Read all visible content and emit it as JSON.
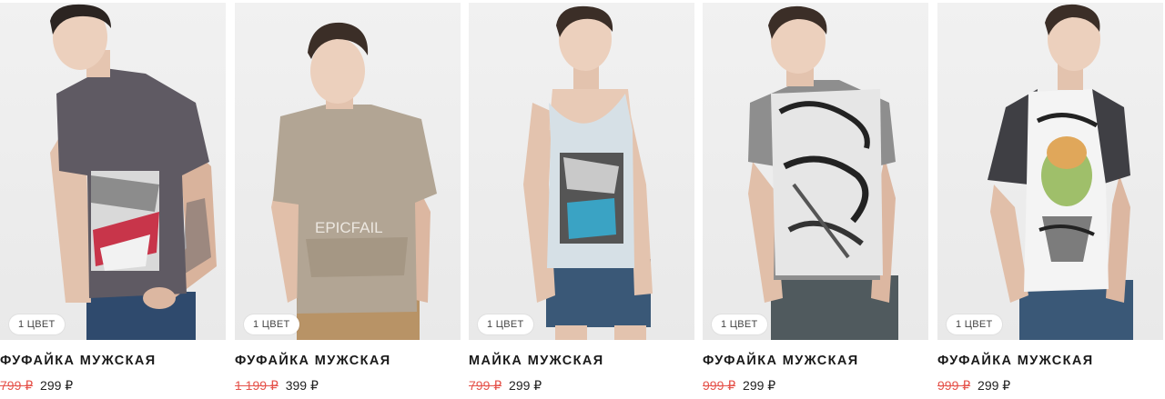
{
  "products": [
    {
      "title": "ФУФАЙКА МУЖСКАЯ",
      "colors_badge": "1 ЦВЕТ",
      "old_price": "799 ₽",
      "new_price": "299 ₽",
      "shirt_color": "#5f5a63",
      "print_text": ""
    },
    {
      "title": "ФУФАЙКА МУЖСКАЯ",
      "colors_badge": "1 ЦВЕТ",
      "old_price": "1 199 ₽",
      "new_price": "399 ₽",
      "shirt_color": "#b2a594",
      "print_text": "EPICFAIL"
    },
    {
      "title": "МАЙКА МУЖСКАЯ",
      "colors_badge": "1 ЦВЕТ",
      "old_price": "799 ₽",
      "new_price": "299 ₽",
      "shirt_color": "#d6e0e6",
      "print_text": ""
    },
    {
      "title": "ФУФАЙКА МУЖСКАЯ",
      "colors_badge": "1 ЦВЕТ",
      "old_price": "999 ₽",
      "new_price": "299 ₽",
      "shirt_color": "#8e8e8e",
      "print_text": ""
    },
    {
      "title": "ФУФАЙКА МУЖСКАЯ",
      "colors_badge": "1 ЦВЕТ",
      "old_price": "999 ₽",
      "new_price": "299 ₽",
      "shirt_color": "#f4f4f4",
      "print_text": ""
    }
  ],
  "colors": {
    "old_price": "#e5534b",
    "new_price": "#222222",
    "title": "#1a1a1a"
  }
}
